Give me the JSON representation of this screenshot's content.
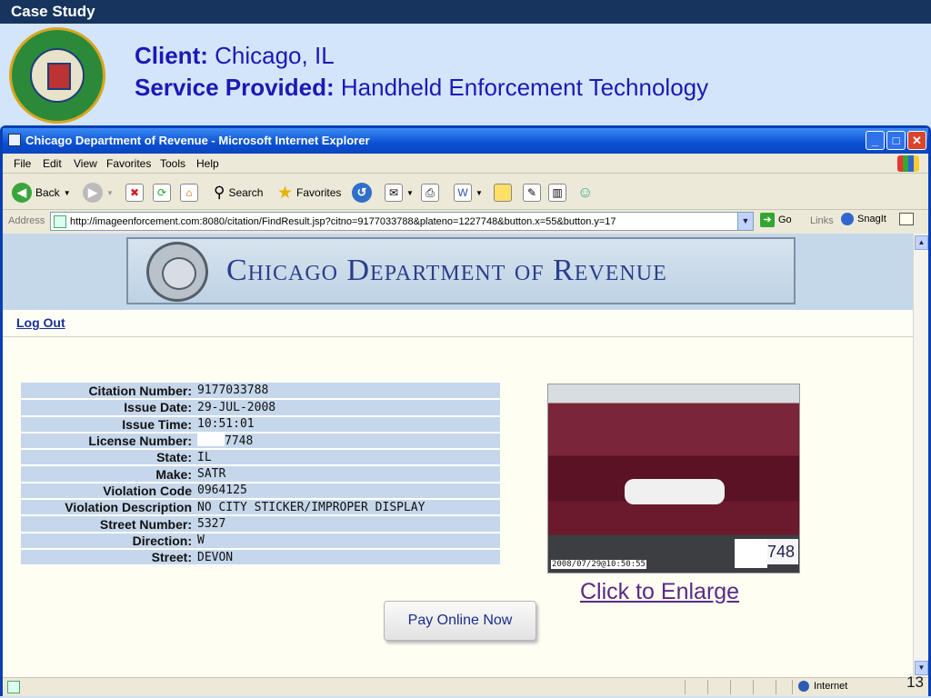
{
  "slide": {
    "header": "Case Study",
    "client_label": "Client:",
    "client_value": "Chicago, IL",
    "service_label": "Service Provided:",
    "service_value": "Handheld Enforcement Technology",
    "page_number": "13"
  },
  "browser": {
    "title": "Chicago Department of Revenue - Microsoft Internet Explorer",
    "menu": [
      "File",
      "Edit",
      "View",
      "Favorites",
      "Tools",
      "Help"
    ],
    "toolbar": {
      "back": "Back",
      "search": "Search",
      "favorites": "Favorites"
    },
    "address_label": "Address",
    "url": "http://imageenforcement.com:8080/citation/FindResult.jsp?citno=9177033788&plateno=1227748&button.x=55&button.y=17",
    "go": "Go",
    "links": "Links",
    "snagit": "SnagIt",
    "status_zone": "Internet"
  },
  "page": {
    "banner_title": "Chicago Department of Revenue",
    "logout": "Log Out",
    "citation": [
      {
        "label": "Citation Number:",
        "value": "9177033788"
      },
      {
        "label": "Issue Date:",
        "value": "29-JUL-2008"
      },
      {
        "label": "Issue Time:",
        "value": "10:51:01"
      },
      {
        "label": "License Number:",
        "value": "7748"
      },
      {
        "label": "State:",
        "value": "IL"
      },
      {
        "label": "Make:",
        "value": "SATR"
      },
      {
        "label": "Violation Code",
        "value": "0964125"
      },
      {
        "label": "Violation Description",
        "value": "NO CITY STICKER/IMPROPER DISPLAY"
      },
      {
        "label": "Street Number:",
        "value": "5327"
      },
      {
        "label": "Direction:",
        "value": "W"
      },
      {
        "label": "Street:",
        "value": "DEVON"
      }
    ],
    "photo_timestamp": "2008/07/29@10:50:55",
    "photo_plate": "7748",
    "enlarge_link": "Click to Enlarge",
    "pay_button": "Pay Online Now"
  }
}
